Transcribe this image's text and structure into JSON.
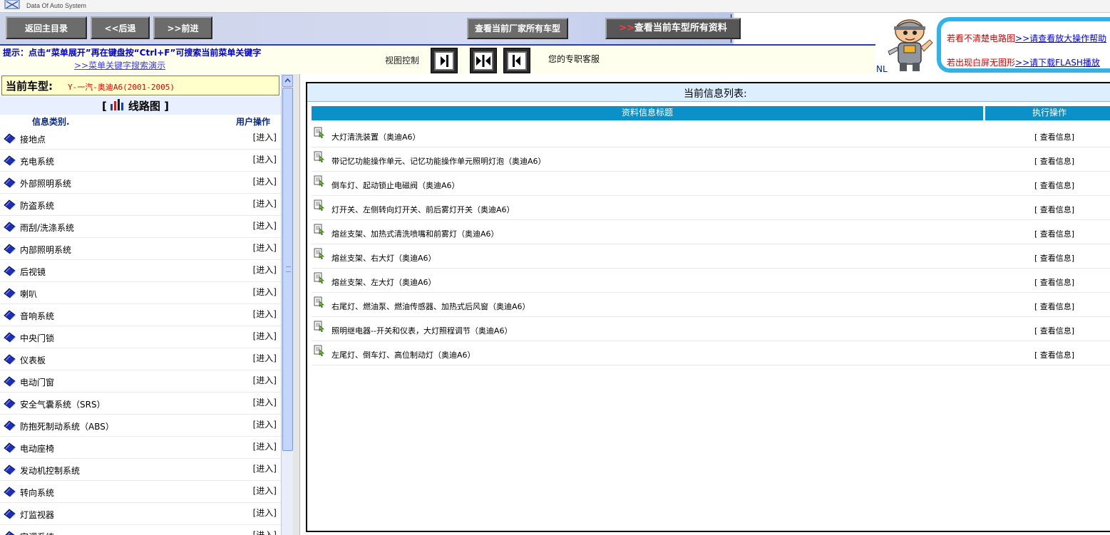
{
  "header": {
    "logo_subtitle": "Data Of Auto System"
  },
  "toolbar": {
    "home_label": "返回主目录",
    "back_label": "<<后退",
    "forward_label": ">>前进",
    "maker_models_label": "查看当前厂家所有车型",
    "model_docs_prefix": ">>",
    "model_docs_label": "查看当前车型所有资料"
  },
  "help_banner": {
    "line1_text": "若看不清楚电路图",
    "line1_link": ">>请查看放大操作帮助",
    "line2_text": "若出现白屏无图形",
    "line2_link": ">>请下载FLASH播放",
    "corner_text": "NL"
  },
  "hint": {
    "text": "提示：点击“菜单展开”再在键盘按“Ctrl+F”可搜索当前菜单关键字",
    "link": ">>菜单关键字搜索演示"
  },
  "view_control": {
    "label": "视图控制",
    "buttons": [
      "left-arrow",
      "both-arrows",
      "right-arrow"
    ]
  },
  "service_text": "您的专职客服",
  "left_panel": {
    "current_model_label": "当前车型:",
    "current_model_value": "Y-一汽-奥迪A6(2001-2005)",
    "category_bracket_open": "[",
    "category_title": "线路图",
    "category_bracket_close": "]",
    "col_category": "信息类别.",
    "col_operation": "用户操作",
    "enter_label": "[进入]",
    "categories": [
      "接地点",
      "充电系统",
      "外部照明系统",
      "防盗系统",
      "雨刮/洗涤系统",
      "内部照明系统",
      "后视镜",
      "喇叭",
      "音响系统",
      "中央门锁",
      "仪表板",
      "电动门窗",
      "安全气囊系统（SRS）",
      "防抱死制动系统（ABS）",
      "电动座椅",
      "发动机控制系统",
      "转向系统",
      "灯监视器",
      "空调系统"
    ]
  },
  "right_panel": {
    "title": "当前信息列表:",
    "col_title": "资料信息标题",
    "col_action": "执行操作",
    "view_label": "[ 查看信息]",
    "rows": [
      "大灯清洗装置（奥迪A6）",
      "带记忆功能操作单元、记忆功能操作单元照明灯泡（奥迪A6）",
      "倒车灯、起动锁止电磁阀（奥迪A6）",
      "灯开关、左侧转向灯开关、前后雾灯开关（奥迪A6）",
      "熔丝支架、加热式清洗喷嘴和前雾灯（奥迪A6）",
      "熔丝支架、右大灯（奥迪A6）",
      "熔丝支架、左大灯（奥迪A6）",
      "右尾灯、燃油泵、燃油传感器、加热式后风窗（奥迪A6）",
      "照明继电器--开关和仪表，大灯照程调节（奥迪A6）",
      "左尾灯、倒车灯、高位制动灯（奥迪A6）"
    ]
  },
  "colors": {
    "header_blue": "#0b91c9",
    "hint_blue": "#0000cc",
    "model_red": "#e00000",
    "help_border": "#2fb3e8"
  }
}
